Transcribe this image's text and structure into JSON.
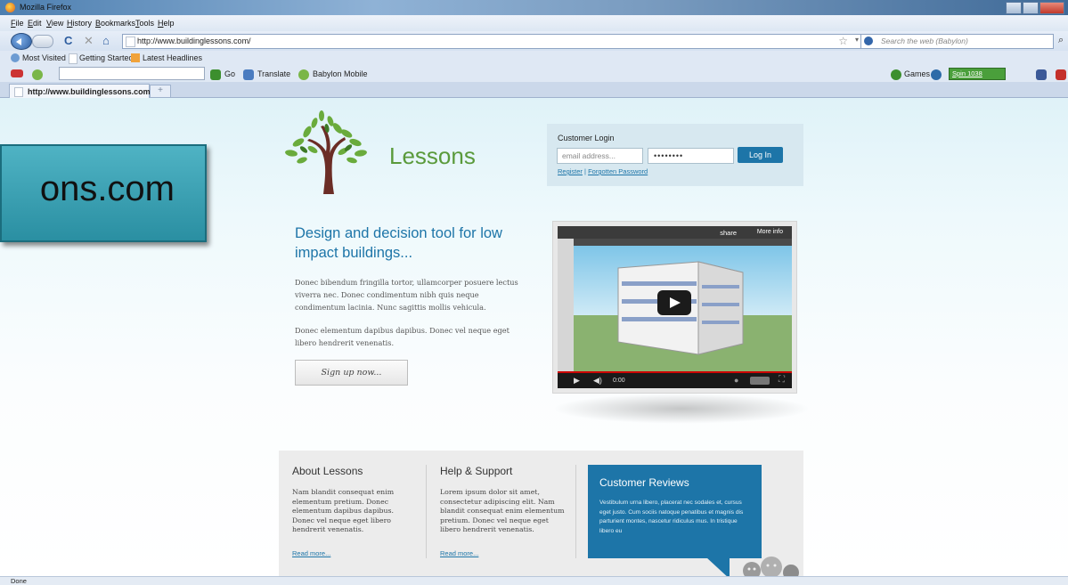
{
  "browser": {
    "window_title": "Mozilla Firefox",
    "menu": [
      "File",
      "Edit",
      "View",
      "History",
      "Bookmarks",
      "Tools",
      "Help"
    ],
    "url": "http://www.buildinglessons.com/",
    "search_placeholder": "Search the web (Babylon)",
    "bookmarks": [
      "Most Visited",
      "Getting Started",
      "Latest Headlines"
    ],
    "toolbar": {
      "go": "Go",
      "translate": "Translate",
      "babylon_mobile": "Babylon Mobile",
      "games": "Games",
      "spin": "Spin 1038"
    },
    "tab_title": "http://www.buildinglessons.com/",
    "new_tab": "+",
    "status": "Done"
  },
  "overlay": {
    "text": "ons.com"
  },
  "site": {
    "brand": "Lessons",
    "login": {
      "title": "Customer Login",
      "email_placeholder": "email address...",
      "password_mask": "••••••••",
      "button": "Log In",
      "register": "Register",
      "separator": "|",
      "forgot": "Forgotten Password"
    },
    "headline": "Design and decision tool for low impact buildings...",
    "para1": "Donec bibendum fringilla tortor, ullamcorper posuere lectus viverra nec. Donec condimentum nibh quis neque condimentum lacinia. Nunc sagittis mollis vehicula.",
    "para2": "Donec elementum dapibus dapibus. Donec vel neque eget libero hendrerit venenatis.",
    "signup": "Sign up now...",
    "video": {
      "share": "share",
      "more_info": "More info",
      "time": "0:00"
    },
    "about": {
      "title": "About Lessons",
      "text": "Nam blandit consequat enim elementum pretium. Donec elementum dapibus dapibus. Donec vel neque eget libero hendrerit venenatis.",
      "link": "Read more..."
    },
    "help": {
      "title": "Help & Support",
      "text": "Lorem ipsum dolor sit amet, consectetur adipiscing elit. Nam blandit consequat enim elementum pretium. Donec vel neque eget libero hendrerit venenatis.",
      "link": "Read more..."
    },
    "reviews": {
      "title": "Customer Reviews",
      "text": "Vestibulum urna libero, placerat nec sodales et, cursus eget justo. Cum sociis natoque penatibus et magnis dis parturient montes, nascetur ridiculus mus. In tristique libero eu"
    }
  },
  "colors": {
    "accent": "#1d75a8",
    "brand_green": "#5a9a3b",
    "overlay_teal": "#3aa3b5"
  }
}
